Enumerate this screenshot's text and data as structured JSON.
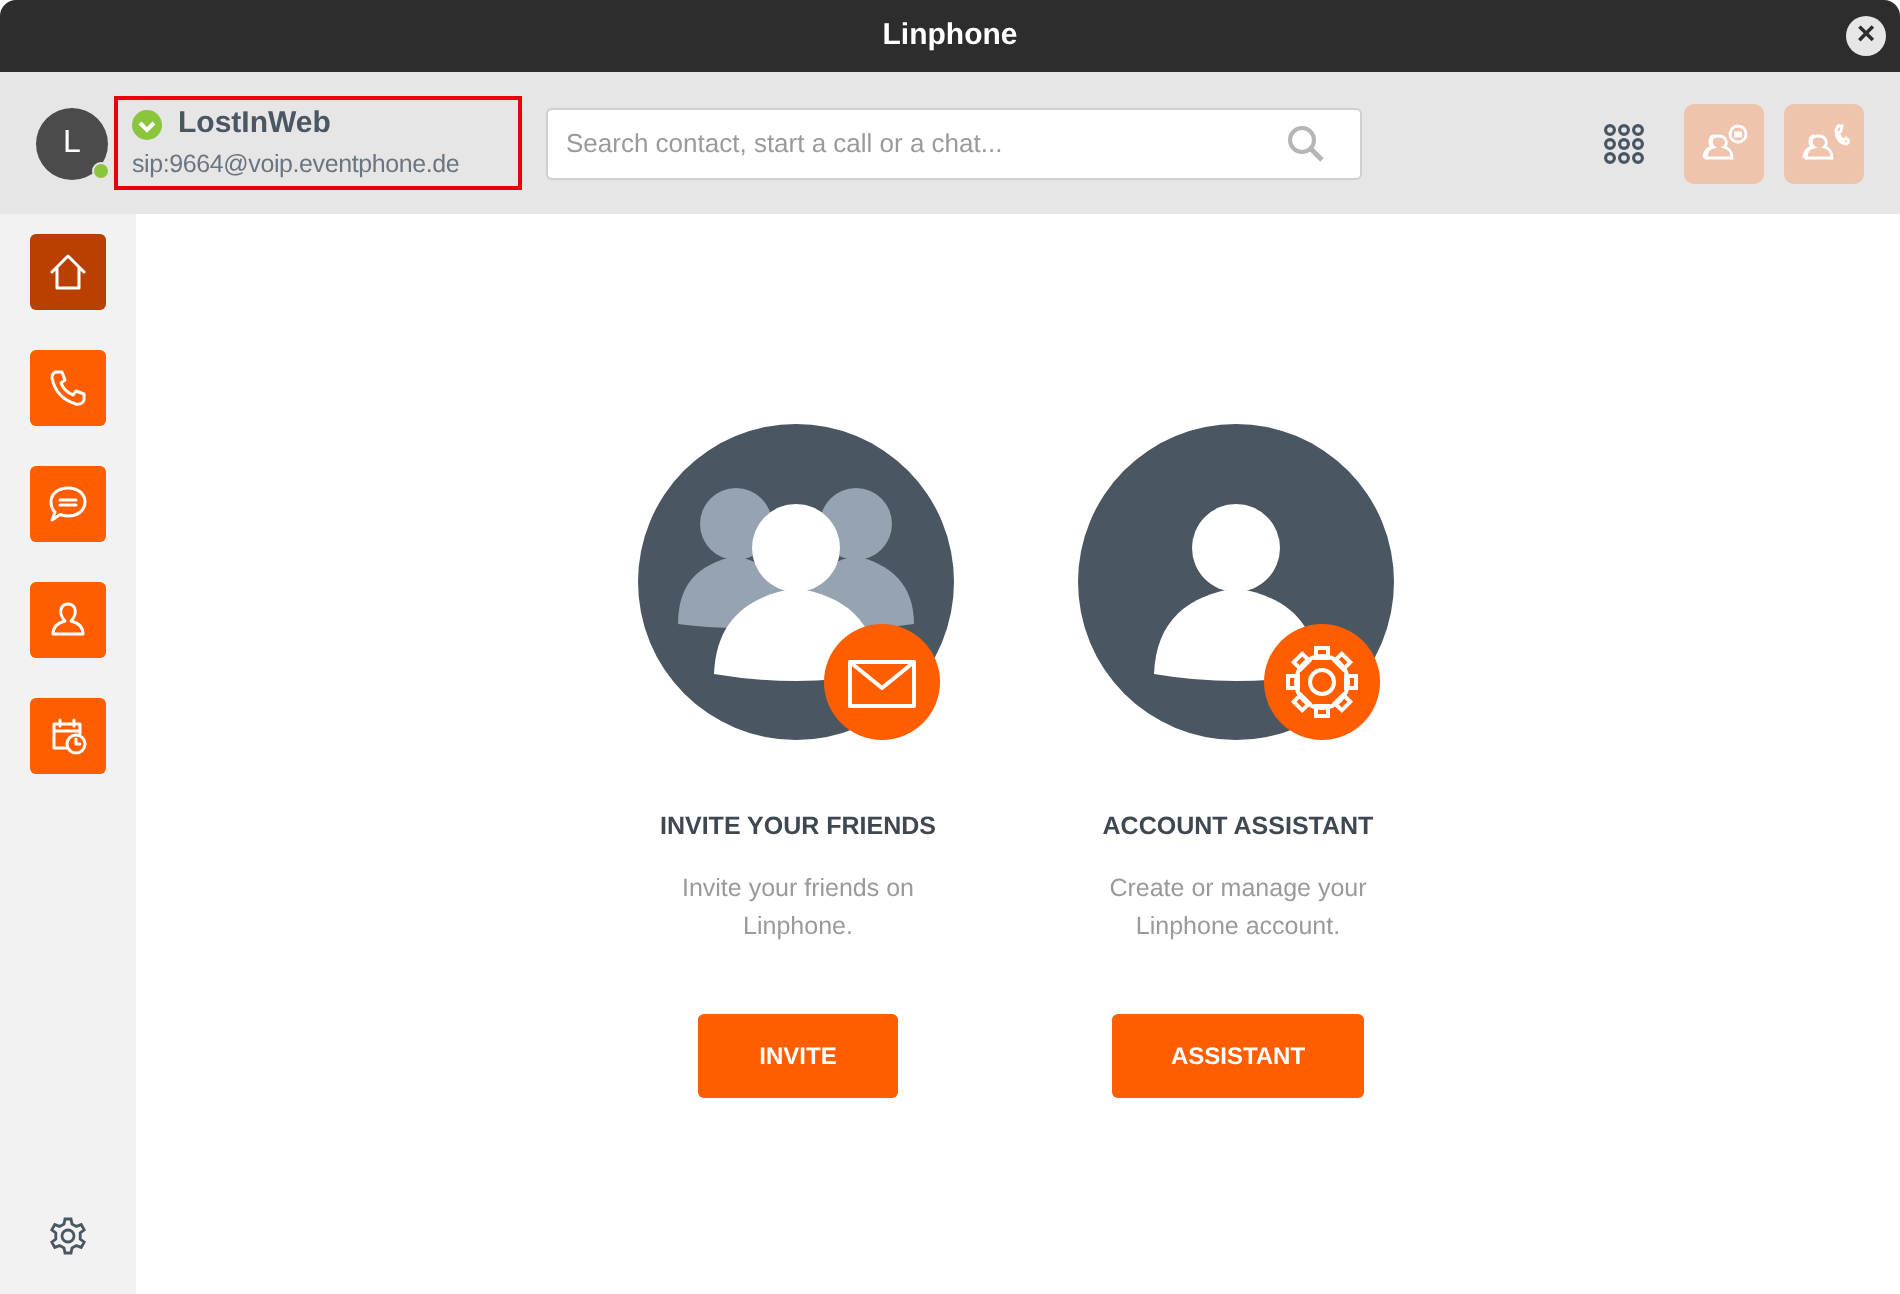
{
  "window": {
    "title": "Linphone",
    "close": "×"
  },
  "account": {
    "avatar_letter": "L",
    "online": true,
    "registered": true,
    "highlighted": true,
    "name": "LostInWeb",
    "address": "sip:9664@voip.eventphone.de"
  },
  "search": {
    "placeholder": "Search contact, start a call or a chat..."
  },
  "toolbar": [
    {
      "kind": "dialpad",
      "disabled": false
    },
    {
      "kind": "conference-chat",
      "disabled": true
    },
    {
      "kind": "conference-call",
      "disabled": true
    }
  ],
  "sidebar": {
    "items": [
      {
        "kind": "home",
        "selected": true
      },
      {
        "kind": "calls",
        "selected": false
      },
      {
        "kind": "chat",
        "selected": false
      },
      {
        "kind": "contacts",
        "selected": false
      },
      {
        "kind": "meetings",
        "selected": false
      }
    ]
  },
  "cards": [
    {
      "kind": "invite",
      "title": "INVITE YOUR FRIENDS",
      "description": "Invite your friends on Linphone.",
      "button": "INVITE"
    },
    {
      "kind": "assistant",
      "title": "ACCOUNT ASSISTANT",
      "description": "Create or manage your Linphone account.",
      "button": "ASSISTANT"
    }
  ]
}
